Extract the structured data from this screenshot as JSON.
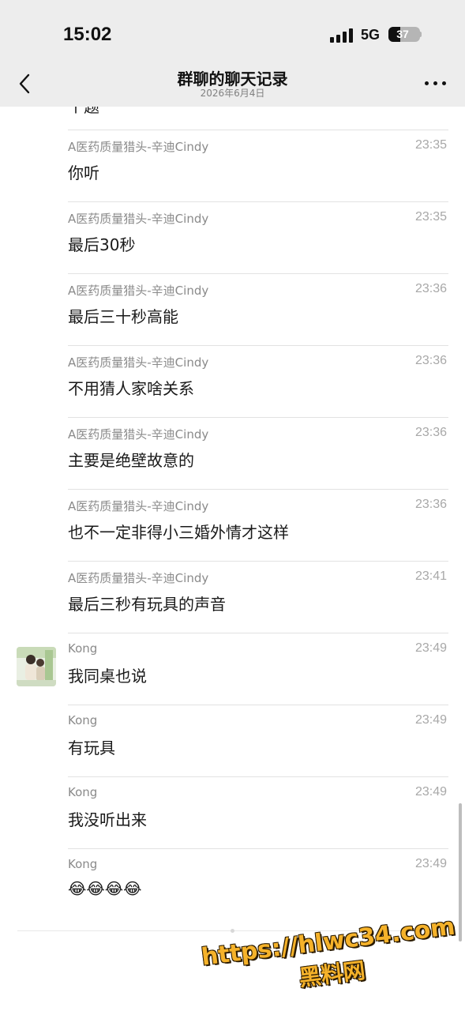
{
  "status_bar": {
    "time": "15:02",
    "network": "5G",
    "battery": "37",
    "battery_level": 0.37
  },
  "header": {
    "title": "群聊的聊天记录",
    "subtitle": "2026年6月4日"
  },
  "partial_message": "个题",
  "messages": [
    {
      "sender": "A医药质量猎头-辛迪Cindy",
      "time": "23:35",
      "text": "你听"
    },
    {
      "sender": "A医药质量猎头-辛迪Cindy",
      "time": "23:35",
      "text": "最后30秒"
    },
    {
      "sender": "A医药质量猎头-辛迪Cindy",
      "time": "23:36",
      "text": "最后三十秒高能"
    },
    {
      "sender": "A医药质量猎头-辛迪Cindy",
      "time": "23:36",
      "text": "不用猜人家啥关系"
    },
    {
      "sender": "A医药质量猎头-辛迪Cindy",
      "time": "23:36",
      "text": "主要是绝壁故意的"
    },
    {
      "sender": "A医药质量猎头-辛迪Cindy",
      "time": "23:36",
      "text": "也不一定非得小三婚外情才这样"
    },
    {
      "sender": "A医药质量猎头-辛迪Cindy",
      "time": "23:41",
      "text": "最后三秒有玩具的声音"
    },
    {
      "sender": "Kong",
      "time": "23:49",
      "text": "我同桌也说"
    },
    {
      "sender": "Kong",
      "time": "23:49",
      "text": "有玩具"
    },
    {
      "sender": "Kong",
      "time": "23:49",
      "text": "我没听出来"
    },
    {
      "sender": "Kong",
      "time": "23:49",
      "text": "😂😂😂😂"
    }
  ],
  "icons": {
    "back": "chevron-left-icon",
    "more": "more-dots-icon",
    "emoji": "laughing-crying-emoji"
  },
  "watermark": {
    "url": "https://hlwc34.com",
    "name": "黑料网"
  },
  "colors": {
    "header_bg": "#ededed",
    "page_bg": "#ffffff",
    "sender": "#8a8a8a",
    "time": "#a8a8a8",
    "watermark": "#f5b22a"
  }
}
